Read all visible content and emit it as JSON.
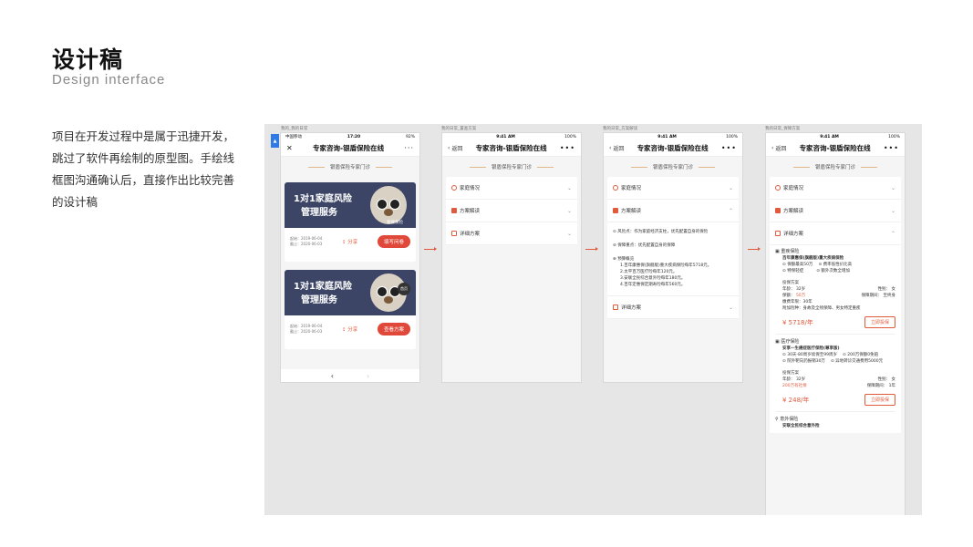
{
  "header": {
    "title": "设计稿",
    "subtitle": "Design interface",
    "description": "项目在开发过程中是属于迅捷开发，跳过了软件再绘制的原型图。手绘线框图沟通确认后，直接作出比较完善的设计稿"
  },
  "frames": [
    {
      "label": "我的_我的日常",
      "status_left": "中国移动",
      "status_time": "17:20",
      "status_right": "92%"
    },
    {
      "label": "我的日常_置查方案",
      "status_left": "",
      "status_time": "9:41 AM",
      "status_right": "100%"
    },
    {
      "label": "我的日常_方案解读",
      "status_left": "",
      "status_time": "9:41 AM",
      "status_right": "100%"
    },
    {
      "label": "我的日常_保障方案",
      "status_left": "",
      "status_time": "9:41 AM",
      "status_right": "100%"
    }
  ],
  "app": {
    "nav_title_1": "专家咨询-银盾保险在线",
    "nav_title_2": "专家咨询-银盾保险在线",
    "back_label": "返回",
    "clinic_label": "银盾保险专家门诊",
    "accordion": {
      "family": "家庭情况",
      "plan": "方案解读",
      "detail": "详细方案"
    },
    "phone1": {
      "banner_title_line1": "1对1家庭风险",
      "banner_title_line2": "管理服务",
      "brand": "要要保险",
      "dates1_line1": "起始：2019-06-04",
      "dates1_line2": "截止：2020-06-03",
      "dates2_line1": "起始：2019-06-04",
      "dates2_line2": "截止：2020-06-03",
      "share": "分享",
      "btn_fill": "填写问卷",
      "btn_view": "查看方案",
      "home": "首页"
    },
    "phone3": {
      "risk": "风险点：作为家庭经济支柱，优先配置自身的保险",
      "focus": "保障重点：优先配置自身的保障",
      "budget_title": "预算概览",
      "budget_1": "1.百年康惠保(旗舰版)重大疾病保险每年5718元。",
      "budget_2": "2.太平百万医疗险每年120元。",
      "budget_3": "3.安联全民综合意外险每年180元。",
      "budget_4": "4.百年定惠保定期寿险每年560元。"
    },
    "phone4": {
      "sec1_tag": "重疾保险",
      "sec1_product": "百年康惠保(旗舰版)重大疾病保险",
      "sec1_f1": "保额最高50万",
      "sec1_f2": "费率低性价比高",
      "sec1_f3": "特保轻症",
      "sec1_f4": "额外次数全增加",
      "plan_label": "投保方案",
      "age_label": "年龄：",
      "age_val": "32岁",
      "gender_label": "性别：",
      "gender_val": "女",
      "amount_label": "保额：",
      "amount_val": "50万",
      "period_label": "保障期间：",
      "period_val": "至终身",
      "pay_label": "缴费年限：30年",
      "extra_label": "附加险种：身故及全残保障、男女特定重疾",
      "price1": "¥ 5718/年",
      "buy": "立即投保",
      "sec2_tag": "医疗保险",
      "sec2_product": "安享一生癌症医疗保险(尊享版)",
      "sec2_f1": "30天-80周岁续保至99周岁",
      "sec2_f2": "200万保额0免赔",
      "sec2_f3": "院外靶向药报销30万",
      "sec2_f4": "异地转诊交通费用5000元",
      "plan2_age": "32岁",
      "plan2_gender": "女",
      "plan2_amount": "200万有社保",
      "plan2_period": "1年",
      "price2": "¥ 248/年",
      "sec3_tag": "意外保险",
      "sec3_product": "安联全民综合意外险"
    }
  }
}
